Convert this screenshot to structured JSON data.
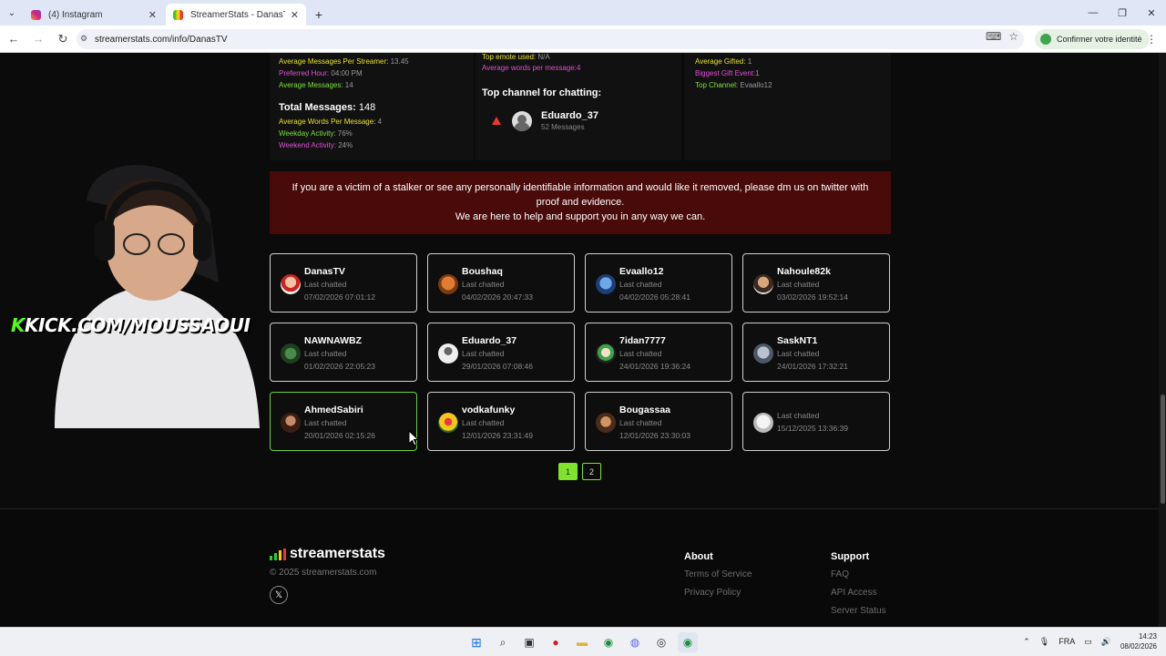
{
  "browser": {
    "tabs": [
      {
        "title": "(4) Instagram",
        "active": false
      },
      {
        "title": "StreamerStats - DanasTV's Prof",
        "active": true
      }
    ],
    "url": "streamerstats.com/info/DanasTV",
    "identity_label": "Confirmer votre identité"
  },
  "stats": {
    "col1": {
      "avg_messages_per_streamer_label": "Average Messages Per Streamer:",
      "avg_messages_per_streamer_value": "13.45",
      "preferred_hour_label": "Preferred Hour:",
      "preferred_hour_value": "04:00 PM",
      "average_messages_label": "Average Messages:",
      "average_messages_value": "14",
      "total_messages_label": "Total Messages:",
      "total_messages_value": "148",
      "avg_words_label": "Average Words Per Message:",
      "avg_words_value": "4",
      "weekday_label": "Weekday Activity:",
      "weekday_value": "76%",
      "weekend_label": "Weekend Activity:",
      "weekend_value": "24%"
    },
    "col2": {
      "top_emote_label": "Top emote used:",
      "top_emote_value": "N/A",
      "avg_words_label": "Average words per message:",
      "avg_words_value": "4",
      "top_channel_title": "Top channel for chatting:",
      "top_channel_name": "Eduardo_37",
      "top_channel_messages": "52 Messages"
    },
    "col3": {
      "avg_gifted_label": "Average Gifted:",
      "avg_gifted_value": "1",
      "biggest_gift_label": "Biggest Gift Event:",
      "biggest_gift_value": "1",
      "top_channel_label": "Top Channel:",
      "top_channel_value": "Evaallo12"
    }
  },
  "banner": {
    "line1": "If you are a victim of a stalker or see any personally identifiable information and would like it removed, please dm us on twitter with",
    "line2": "proof and evidence.",
    "line3": "We are here to help and support you in any way we can."
  },
  "channels": [
    {
      "name": "DanasTV",
      "label": "Last chatted",
      "date": "07/02/2026 07:01:12"
    },
    {
      "name": "Boushaq",
      "label": "Last chatted",
      "date": "04/02/2026 20:47:33"
    },
    {
      "name": "Evaallo12",
      "label": "Last chatted",
      "date": "04/02/2026 05:28:41"
    },
    {
      "name": "Nahoule82k",
      "label": "Last chatted",
      "date": "03/02/2026 19:52:14"
    },
    {
      "name": "NAWNAWBZ",
      "label": "Last chatted",
      "date": "01/02/2026 22:05:23"
    },
    {
      "name": "Eduardo_37",
      "label": "Last chatted",
      "date": "29/01/2026 07:08:46"
    },
    {
      "name": "7idan7777",
      "label": "Last chatted",
      "date": "24/01/2026 19:36:24"
    },
    {
      "name": "SaskNT1",
      "label": "Last chatted",
      "date": "24/01/2026 17:32:21"
    },
    {
      "name": "AhmedSabiri",
      "label": "Last chatted",
      "date": "20/01/2026 02:15:26"
    },
    {
      "name": "vodkafunky",
      "label": "Last chatted",
      "date": "12/01/2026 23:31:49"
    },
    {
      "name": "Bougassaa",
      "label": "Last chatted",
      "date": "12/01/2026 23:30:03"
    },
    {
      "name": "",
      "label": "Last chatted",
      "date": "15/12/2025 13:36:39"
    }
  ],
  "pagination": {
    "pages": [
      "1",
      "2"
    ],
    "current": "1"
  },
  "footer": {
    "brand": "streamerstats",
    "copyright": "© 2025 streamerstats.com",
    "x_label": "𝕏",
    "about_title": "About",
    "about_links": [
      "Terms of Service",
      "Privacy Policy"
    ],
    "support_title": "Support",
    "support_links": [
      "FAQ",
      "API Access",
      "Server Status"
    ]
  },
  "overlay": {
    "kick_k": "K",
    "kick_text": "KICK.COM/MOUSSAOUI"
  },
  "taskbar": {
    "lang": "FRA",
    "time": "14:23",
    "date": "08/02/2026"
  },
  "colors": {
    "accent": "#7fe32b",
    "banner_bg": "#490a0a",
    "stat_yellow": "#e9e12f",
    "stat_pink": "#e04fd5",
    "stat_green": "#7be23e"
  }
}
